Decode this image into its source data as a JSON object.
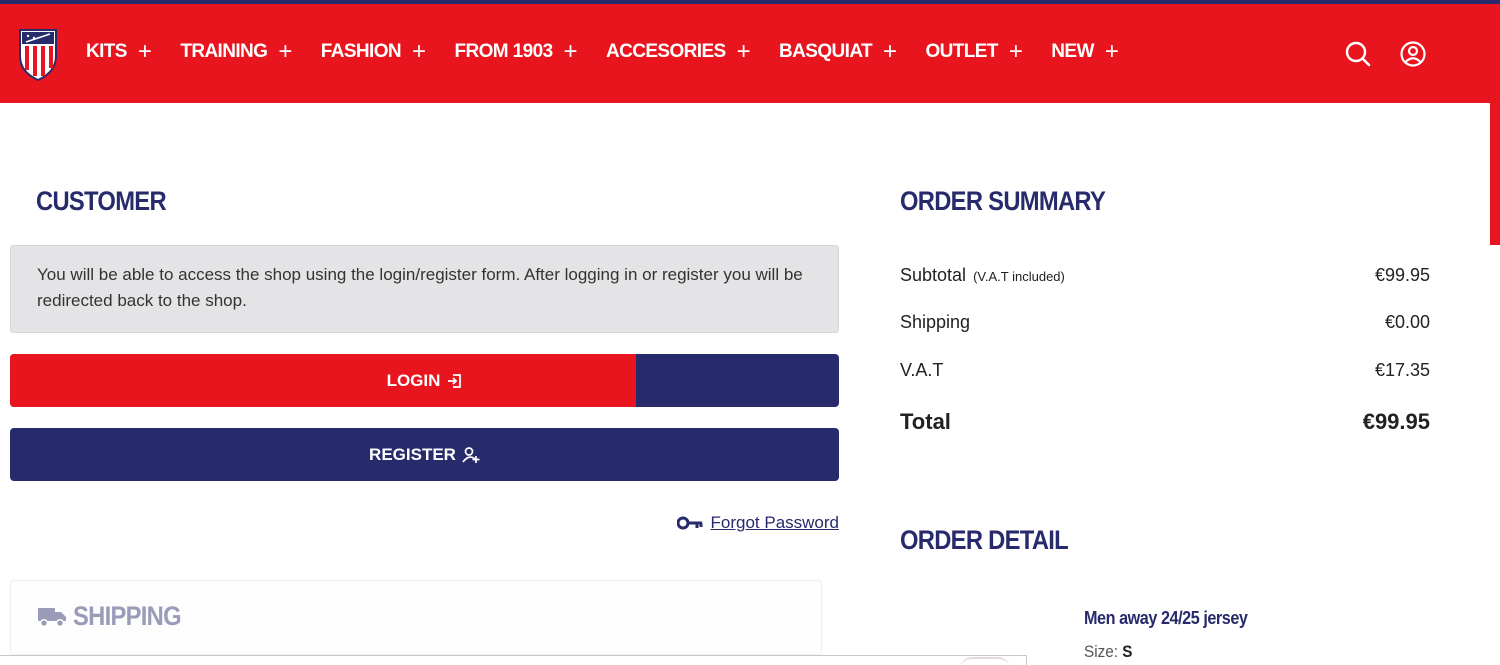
{
  "header": {
    "logo": "atletico-crest-logo",
    "nav": [
      {
        "label": "KITS"
      },
      {
        "label": "TRAINING"
      },
      {
        "label": "FASHION"
      },
      {
        "label": "FROM 1903"
      },
      {
        "label": "ACCESORIES"
      },
      {
        "label": "BASQUIAT"
      },
      {
        "label": "OUTLET"
      },
      {
        "label": "NEW"
      }
    ],
    "nav_plus": "+",
    "icons": [
      "search-icon",
      "user-account-icon"
    ]
  },
  "customer": {
    "title": "CUSTOMER",
    "info": "You will be able to access the shop using the login/register form. After logging in or register you will be redirected back to the shop.",
    "login_label": "LOGIN",
    "login_progress": 0.755,
    "register_label": "REGISTER",
    "forgot_label": "Forgot Password"
  },
  "shipping": {
    "title": "SHIPPING"
  },
  "summary": {
    "title": "ORDER SUMMARY",
    "subtotal_label": "Subtotal",
    "subtotal_note": "(V.A.T included)",
    "subtotal_value": "€99.95",
    "shipping_label": "Shipping",
    "shipping_value": "€0.00",
    "vat_label": "V.A.T",
    "vat_value": "€17.35",
    "total_label": "Total",
    "total_value": "€99.95"
  },
  "detail": {
    "title": "ORDER DETAIL",
    "product_name": "Men away 24/25 jersey",
    "size_label": "Size:",
    "size_value": "S"
  },
  "colors": {
    "brand_red": "#e8141e",
    "brand_navy": "#272a6b",
    "info_gray": "#e4e4e6"
  }
}
